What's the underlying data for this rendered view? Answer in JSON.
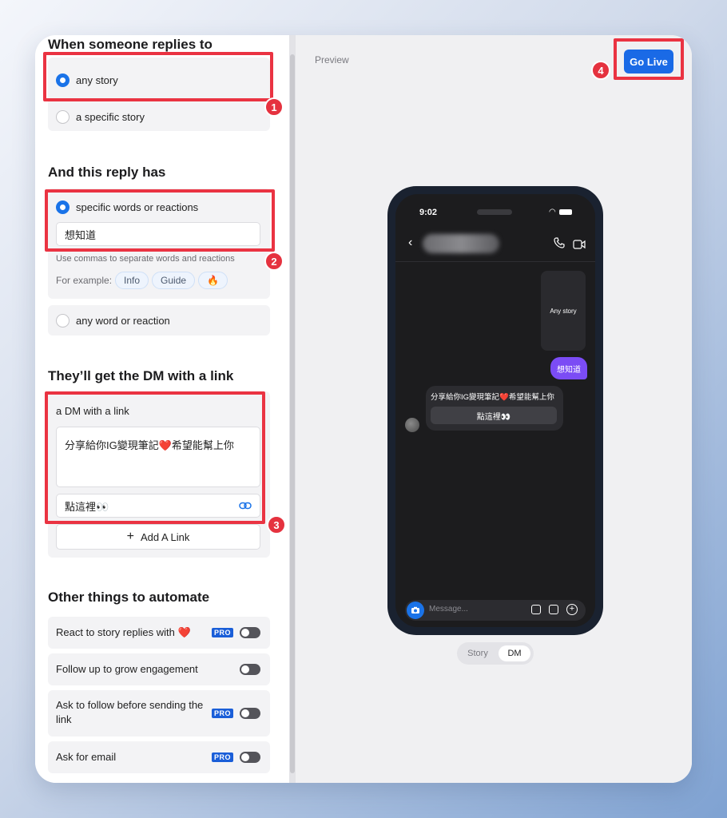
{
  "trigger": {
    "heading": "When someone replies to",
    "options": [
      {
        "label": "any story",
        "selected": true
      },
      {
        "label": "a specific story",
        "selected": false
      }
    ]
  },
  "reply": {
    "heading": "And this reply has",
    "options": [
      {
        "label": "specific words or reactions",
        "selected": true
      },
      {
        "label": "any word or reaction",
        "selected": false
      }
    ],
    "keywords_value": "想知道",
    "hint": "Use commas to separate words and reactions",
    "example_label": "For example:",
    "examples": [
      "Info",
      "Guide",
      "🔥"
    ]
  },
  "dm": {
    "heading": "They’ll get the DM with a link",
    "option_label": "a DM with a link",
    "message": "分享給你IG變現筆記❤️希望能幫上你",
    "link_label": "點這裡👀",
    "add_link": "Add A Link"
  },
  "automate": {
    "heading": "Other things to automate",
    "items": [
      {
        "label": "React to story replies with ❤️",
        "pro": true,
        "enabled": false
      },
      {
        "label": "Follow up to grow engagement",
        "pro": false,
        "enabled": false
      },
      {
        "label": "Ask to follow before sending the link",
        "pro": true,
        "enabled": false
      },
      {
        "label": "Ask for email",
        "pro": true,
        "enabled": false
      }
    ],
    "pro_badge": "PRO"
  },
  "preview": {
    "label": "Preview",
    "go_live": "Go Live",
    "phone": {
      "time": "9:02",
      "story_card": "Any story",
      "user_reply": "想知道",
      "bot_message": "分享給你IG變現筆記❤️希望能幫上你",
      "bot_link": "點這裡👀",
      "message_placeholder": "Message..."
    },
    "tabs": [
      {
        "label": "Story",
        "active": false
      },
      {
        "label": "DM",
        "active": true
      }
    ]
  },
  "annotations": [
    "1",
    "2",
    "3",
    "4"
  ],
  "colors": {
    "accent": "#1a73e8",
    "annotation": "#ea3342",
    "bubble_user": "#7b4cf5"
  }
}
